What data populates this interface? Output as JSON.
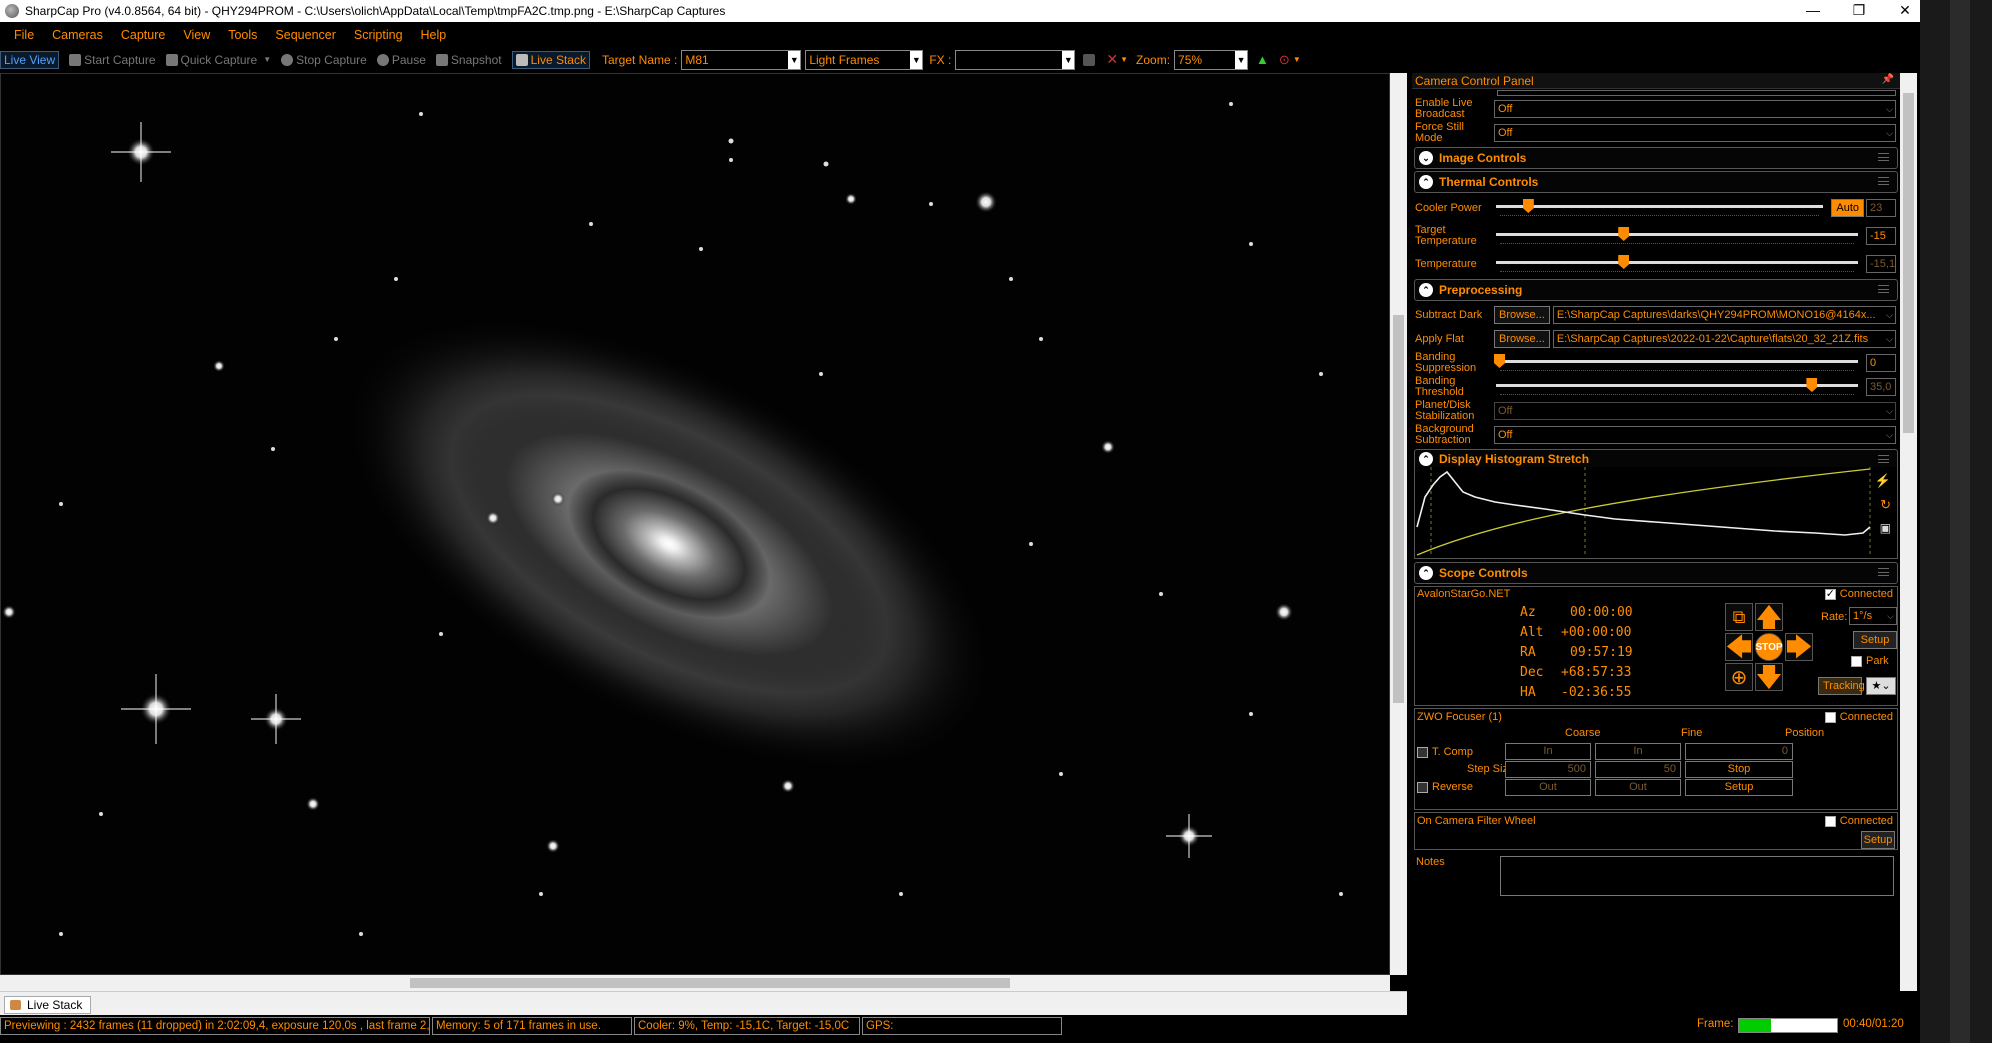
{
  "window": {
    "title": "SharpCap Pro (v4.0.8564, 64 bit) - QHY294PROM - C:\\Users\\olich\\AppData\\Local\\Temp\\tmpFA2C.tmp.png - E:\\SharpCap Captures",
    "minimize": "—",
    "maximize": "❐",
    "close": "✕"
  },
  "menu": [
    "File",
    "Cameras",
    "Capture",
    "View",
    "Tools",
    "Sequencer",
    "Scripting",
    "Help"
  ],
  "toolbar": {
    "live_view": "Live View",
    "start_capture": "Start Capture",
    "quick_capture": "Quick Capture",
    "stop_capture": "Stop Capture",
    "pause": "Pause",
    "snapshot": "Snapshot",
    "live_stack": "Live Stack",
    "target_name_label": "Target Name :",
    "target_name_value": "M81",
    "frame_type": "Light Frames",
    "fx_label": "FX :",
    "fx_value": "",
    "zoom_label": "Zoom:",
    "zoom_value": "75%"
  },
  "panel": {
    "title": "Camera Control Panel",
    "pin": "📌",
    "enable_live_broadcast_label": "Enable Live Broadcast",
    "enable_live_broadcast_value": "Off",
    "force_still_label": "Force Still Mode",
    "force_still_value": "Off",
    "image_controls": "Image Controls",
    "thermal_controls": "Thermal Controls",
    "cooler_power_label": "Cooler Power",
    "cooler_power_auto": "Auto",
    "cooler_power_value": "23",
    "cooler_power_fraction": 0.09,
    "target_temp_label": "Target Temperature",
    "target_temp_value": "-15",
    "target_temp_fraction": 0.35,
    "temp_label": "Temperature",
    "temp_value": "-15,1",
    "temp_fraction": 0.35,
    "preprocessing": "Preprocessing",
    "subtract_dark_label": "Subtract Dark",
    "subtract_dark_browse": "Browse...",
    "subtract_dark_value": "E:\\SharpCap Captures\\darks\\QHY294PROM\\MONO16@4164x...",
    "apply_flat_label": "Apply Flat",
    "apply_flat_browse": "Browse...",
    "apply_flat_value": "E:\\SharpCap Captures\\2022-01-22\\Capture\\flats\\20_32_21Z.fits",
    "banding_supp_label": "Banding Suppression",
    "banding_supp_value": "0",
    "banding_supp_fraction": 0.0,
    "banding_thr_label": "Banding Threshold",
    "banding_thr_value": "35,0",
    "banding_thr_fraction": 0.88,
    "planet_stab_label": "Planet/Disk Stabilization",
    "planet_stab_value": "Off",
    "bg_sub_label": "Background Subtraction",
    "bg_sub_value": "Off",
    "histogram_title": "Display Histogram Stretch",
    "scope_controls": "Scope Controls",
    "scope_name": "AvalonStarGo.NET",
    "scope_connected": "Connected",
    "az_label": "Az",
    "az_value": "00:00:00",
    "alt_label": "Alt",
    "alt_value": "+00:00:00",
    "ra_label": "RA",
    "ra_value": "09:57:19",
    "dec_label": "Dec",
    "dec_value": "+68:57:33",
    "ha_label": "HA",
    "ha_value": "-02:36:55",
    "stop": "STOP",
    "rate_label": "Rate:",
    "rate_value": "1°/s",
    "setup": "Setup",
    "park": "Park",
    "tracking": "Tracking",
    "focuser_name": "ZWO Focuser (1)",
    "focuser_connected": "Connected",
    "coarse": "Coarse",
    "fine": "Fine",
    "position": "Position",
    "tcomp": "T. Comp",
    "step_size": "Step Size",
    "reverse": "Reverse",
    "in1": "In",
    "in2": "In",
    "pos_value": "0",
    "coarse_step": "500",
    "fine_step": "50",
    "stop_btn": "Stop",
    "out1": "Out",
    "out2": "Out",
    "focuser_setup": "Setup",
    "filter_wheel": "On Camera Filter Wheel",
    "filter_connected": "Connected",
    "filter_setup": "Setup",
    "notes_label": "Notes"
  },
  "tab": "Live Stack",
  "status": {
    "previewing": "Previewing : 2432 frames (11 dropped) in 2:02:09,4, exposure 120,0s , last frame 2,",
    "memory": "Memory: 5 of 171 frames in use.",
    "cooler": "Cooler: 9%, Temp: -15,1C, Target: -15,0C",
    "gps": "GPS:",
    "frame_label": "Frame:",
    "frame_time": "00:40/01:20",
    "frame_progress": 0.33
  },
  "colors": {
    "accent": "#ff8c00",
    "background": "#000000",
    "histogram_curve": "#cccc33"
  }
}
